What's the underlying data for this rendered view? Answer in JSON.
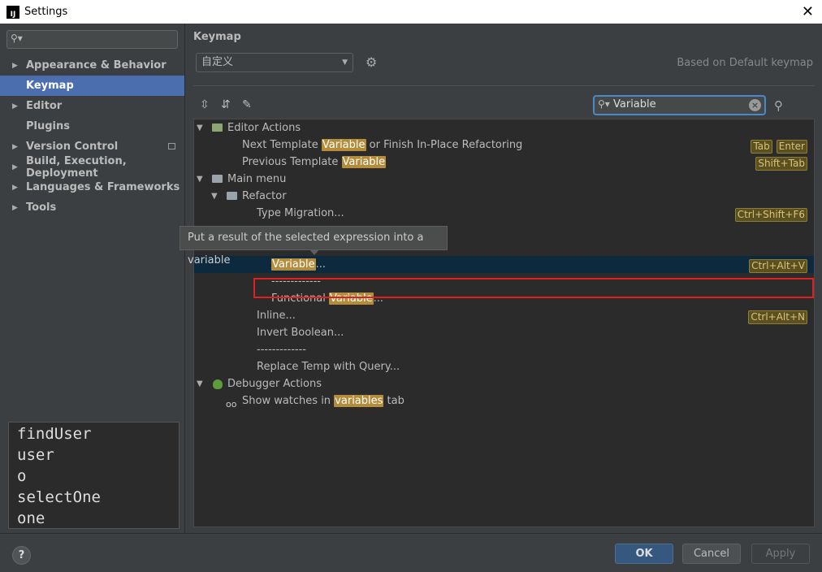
{
  "window": {
    "title": "Settings",
    "app_icon": "IJ"
  },
  "sidebar": {
    "search_placeholder": "",
    "items": [
      {
        "label": "Appearance & Behavior",
        "expandable": true,
        "selected": false
      },
      {
        "label": "Keymap",
        "expandable": false,
        "selected": true
      },
      {
        "label": "Editor",
        "expandable": true,
        "selected": false
      },
      {
        "label": "Plugins",
        "expandable": false,
        "selected": false
      },
      {
        "label": "Version Control",
        "expandable": true,
        "selected": false,
        "badge": "copy-icon"
      },
      {
        "label": "Build, Execution, Deployment",
        "expandable": true,
        "selected": false
      },
      {
        "label": "Languages & Frameworks",
        "expandable": true,
        "selected": false
      },
      {
        "label": "Tools",
        "expandable": true,
        "selected": false
      }
    ]
  },
  "completion": {
    "items": [
      "findUser",
      "user",
      "o",
      "selectOne",
      "one"
    ]
  },
  "keymap": {
    "heading": "Keymap",
    "selected_keymap": "自定义",
    "based_on": "Based on Default keymap",
    "filter_value": "Variable"
  },
  "tooltip": "Put a result of the selected expression into a variable",
  "tree": {
    "editor_actions": "Editor Actions",
    "next_template_pre": "Next Template ",
    "next_template_hl": "Variable",
    "next_template_post": " or Finish In-Place Refactoring",
    "next_template_keys": [
      "Tab",
      "Enter"
    ],
    "prev_template_pre": "Previous Template ",
    "prev_template_hl": "Variable",
    "prev_template_keys": [
      "Shift+Tab"
    ],
    "main_menu": "Main menu",
    "refactor": "Refactor",
    "type_migration": "Type Migration...",
    "type_migration_keys": [
      "Ctrl+Shift+F6"
    ],
    "variable_hl": "Variable",
    "variable_post": "...",
    "variable_keys": [
      "Ctrl+Alt+V"
    ],
    "separator1": "-------------",
    "functional_pre": "Functional ",
    "functional_hl": "Variable",
    "functional_post": "...",
    "inline": "Inline...",
    "inline_keys": [
      "Ctrl+Alt+N"
    ],
    "invert_boolean": "Invert Boolean...",
    "separator2": "-------------",
    "replace_temp": "Replace Temp with Query...",
    "debugger_actions": "Debugger Actions",
    "show_watches_pre": "Show watches in ",
    "show_watches_hl": "variables",
    "show_watches_post": " tab"
  },
  "footer": {
    "ok": "OK",
    "cancel": "Cancel",
    "apply": "Apply",
    "help": "?"
  },
  "colors": {
    "selection": "#4b6eaf",
    "highlight": "#b58c3a",
    "red_box": "#e02020",
    "ok_button": "#365880"
  }
}
